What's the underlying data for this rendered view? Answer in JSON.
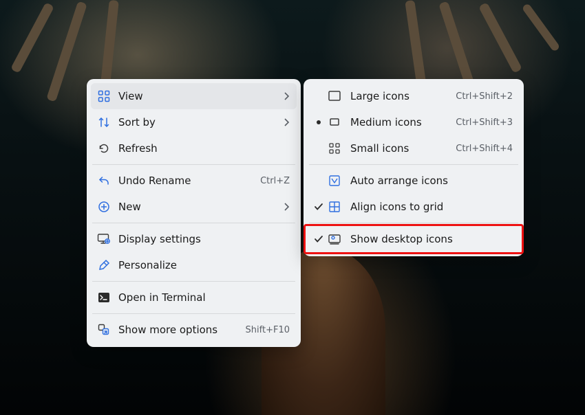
{
  "primary_menu": {
    "view": {
      "label": "View",
      "has_submenu": true
    },
    "sort_by": {
      "label": "Sort by",
      "has_submenu": true
    },
    "refresh": {
      "label": "Refresh"
    },
    "undo_rename": {
      "label": "Undo Rename",
      "shortcut": "Ctrl+Z"
    },
    "new": {
      "label": "New",
      "has_submenu": true
    },
    "display_settings": {
      "label": "Display settings"
    },
    "personalize": {
      "label": "Personalize"
    },
    "open_terminal": {
      "label": "Open in Terminal"
    },
    "show_more": {
      "label": "Show more options",
      "shortcut": "Shift+F10"
    }
  },
  "view_submenu": {
    "large": {
      "label": "Large icons",
      "shortcut": "Ctrl+Shift+2"
    },
    "medium": {
      "label": "Medium icons",
      "shortcut": "Ctrl+Shift+3",
      "selected": true
    },
    "small": {
      "label": "Small icons",
      "shortcut": "Ctrl+Shift+4"
    },
    "auto": {
      "label": "Auto arrange icons",
      "checked": false
    },
    "align": {
      "label": "Align icons to grid",
      "checked": true
    },
    "show": {
      "label": "Show desktop icons",
      "checked": true,
      "highlighted": true
    }
  },
  "colors": {
    "icon_blue": "#2f6fe0",
    "highlight": "#e11"
  }
}
